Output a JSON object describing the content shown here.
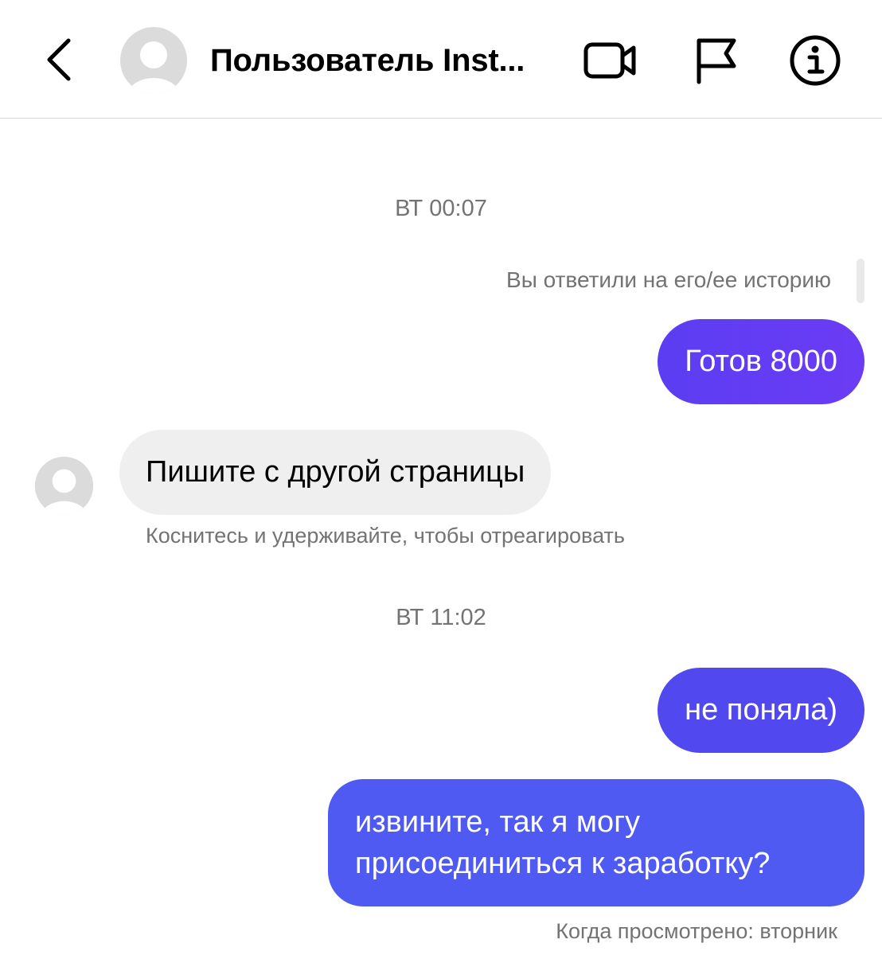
{
  "header": {
    "title": "Пользователь Inst...",
    "icons": [
      "back-arrow-icon",
      "avatar-placeholder-icon",
      "video-camera-icon",
      "flag-icon",
      "info-icon"
    ]
  },
  "messages": {
    "timestamp_1": "ВТ 00:07",
    "story_reply_note": "Вы ответили на его/ее историю",
    "outgoing_1": "Готов 8000",
    "incoming_1": "Пишите с другой страницы",
    "react_hint": "Коснитесь и удерживайте, чтобы отреагировать",
    "timestamp_2": "ВТ 11:02",
    "outgoing_2": "не поняла)",
    "outgoing_3_line_1": "извините, так я могу",
    "outgoing_3_line_2": "присоединиться к заработку?",
    "seen_status": "Когда просмотрено: вторник"
  },
  "colors": {
    "outgoing_bubble_1": "#5b3df2",
    "outgoing_bubble_2": "#5149ef",
    "outgoing_bubble_3": "#4e5af2",
    "incoming_bubble": "#efefef",
    "meta_text": "#737373"
  }
}
